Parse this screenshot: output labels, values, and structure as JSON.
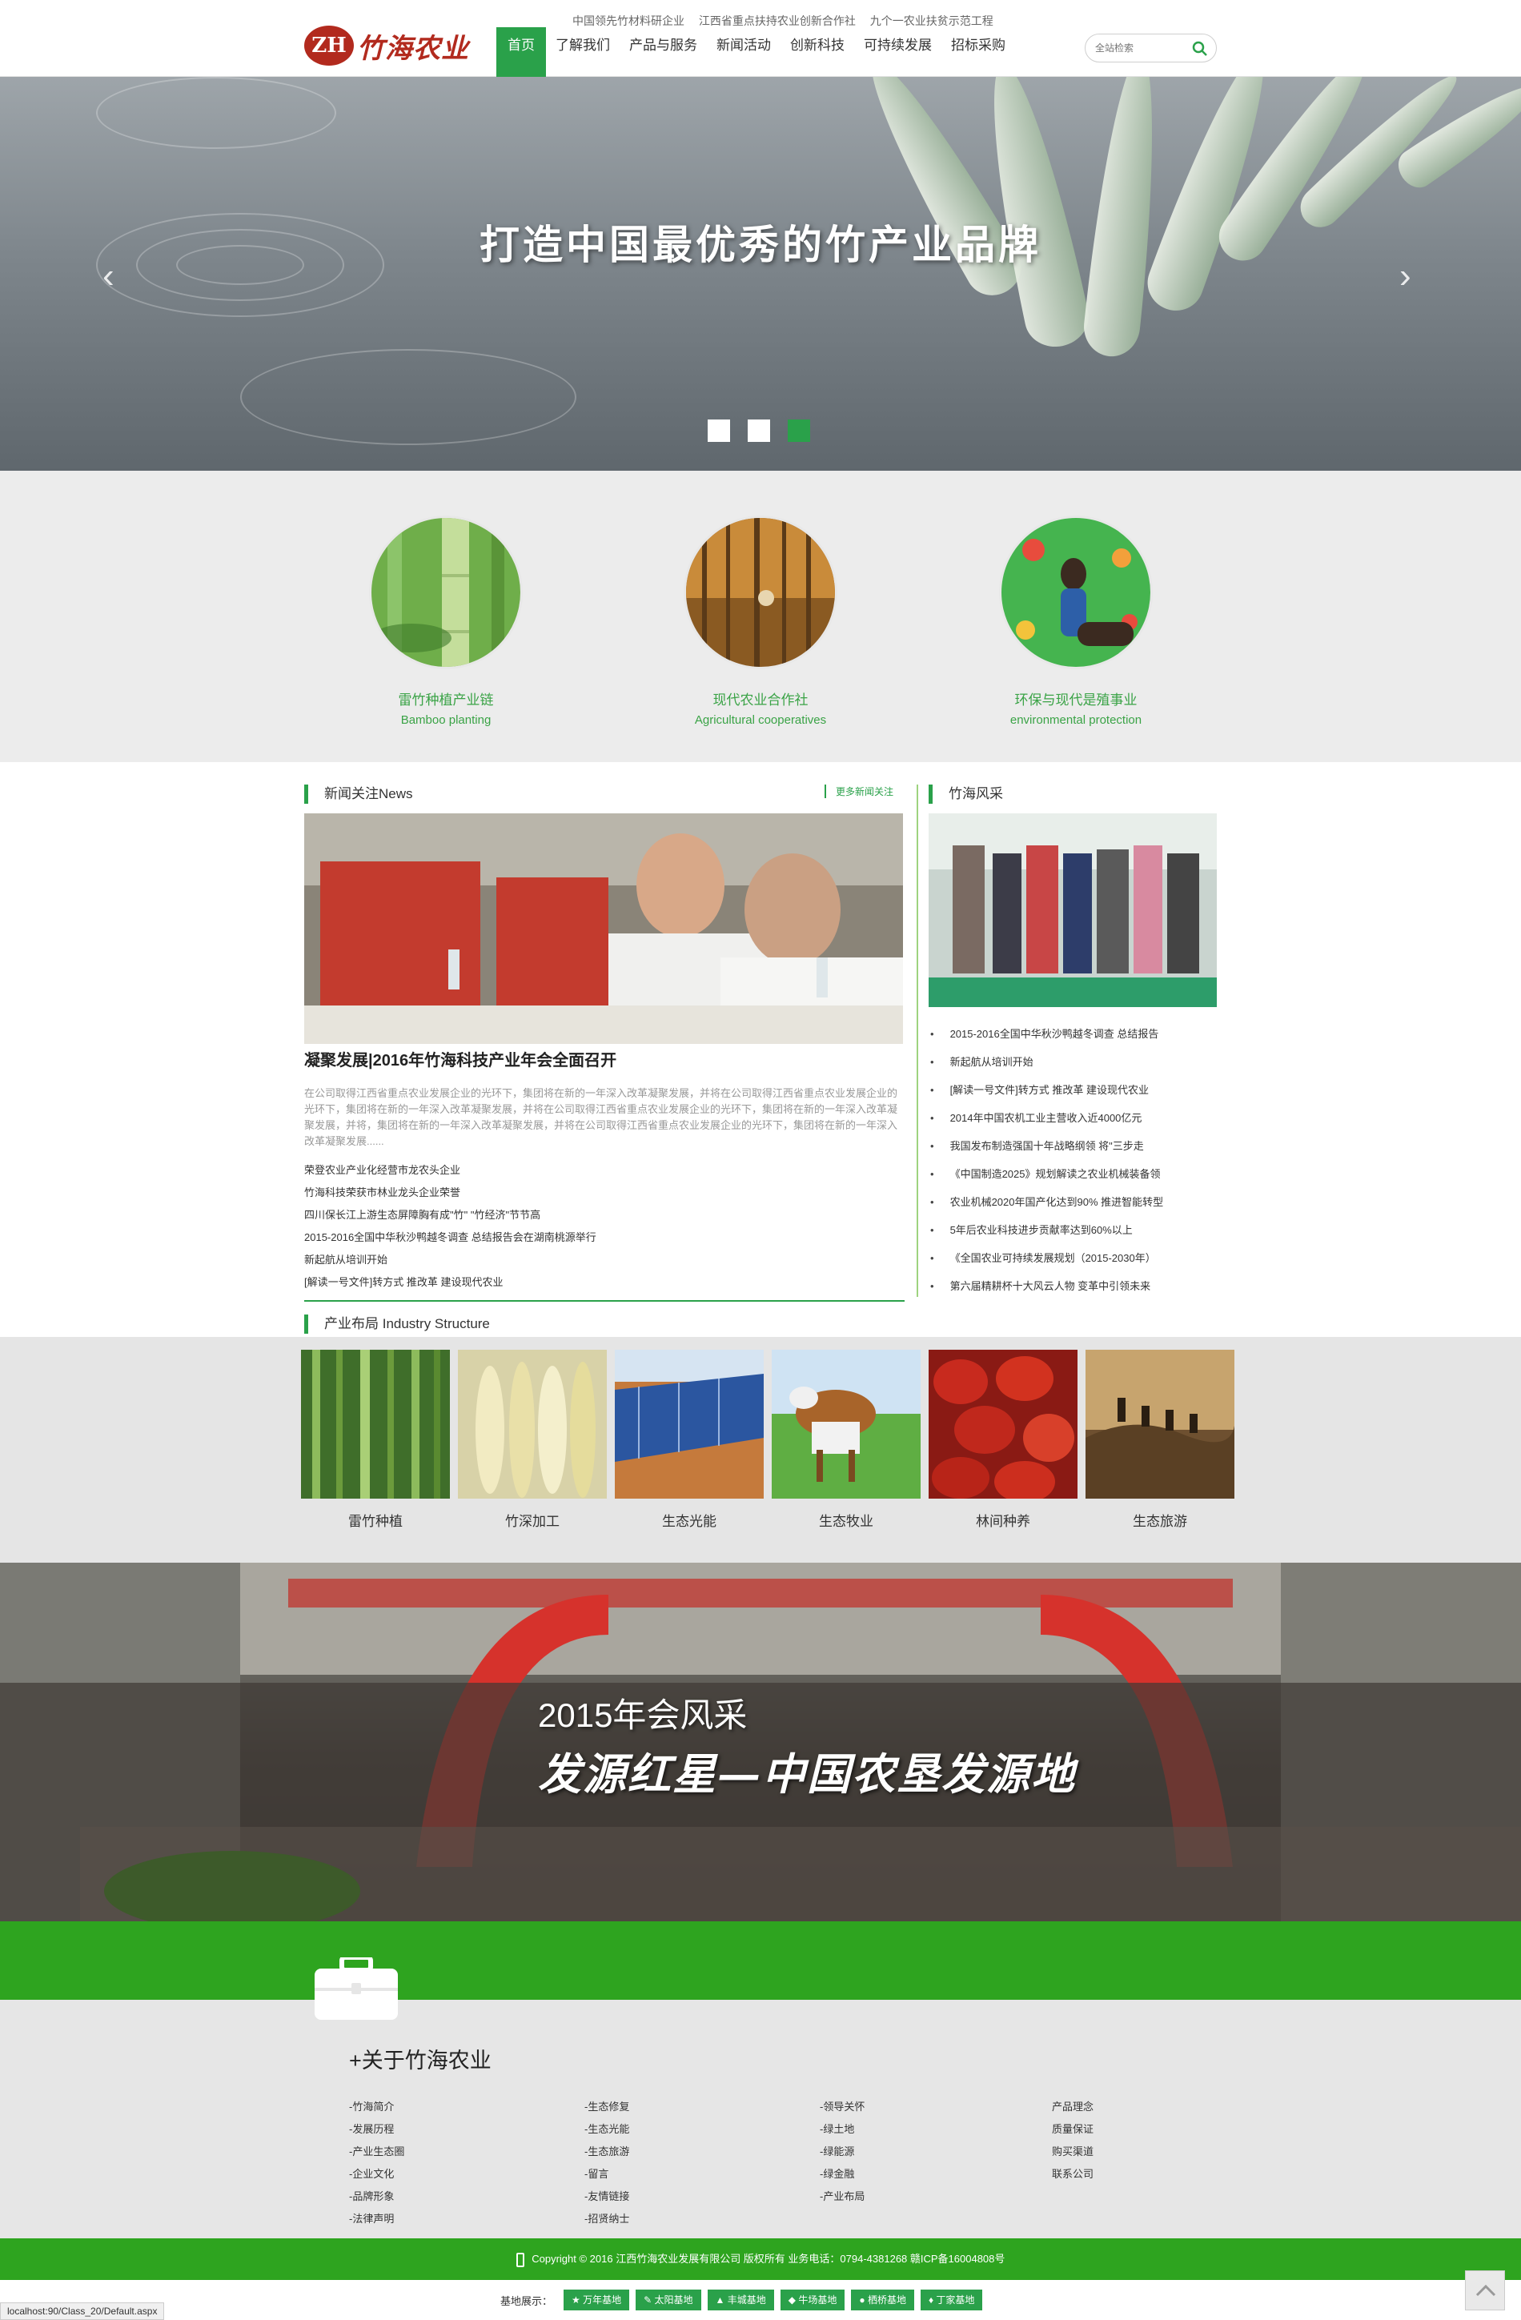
{
  "header": {
    "logo_badge": "ZH",
    "logo_text": "竹海农业",
    "taglines": [
      "中国领先竹材料研企业",
      "江西省重点扶持农业创新合作社",
      "九个一农业扶贫示范工程"
    ],
    "nav": [
      "首页",
      "了解我们",
      "产品与服务",
      "新闻活动",
      "创新科技",
      "可持续发展",
      "招标采购"
    ],
    "search_placeholder": "全站检索"
  },
  "banner": {
    "title": "打造中国最优秀的竹产业品牌",
    "prev": "‹",
    "next": "›",
    "slide_count": 3,
    "active_slide": 3
  },
  "features": [
    {
      "cn": "雷竹种植产业链",
      "en": "Bamboo planting"
    },
    {
      "cn": "现代农业合作社",
      "en": "Agricultural cooperatives"
    },
    {
      "cn": "环保与现代是殖事业",
      "en": "environmental protection"
    }
  ],
  "news": {
    "heading": "新闻关注News",
    "more": "更多新闻关注",
    "headline": "凝聚发展|2016年竹海科技产业年会全面召开",
    "summary": "在公司取得江西省重点农业发展企业的光环下，集团将在新的一年深入改革凝聚发展，并将在公司取得江西省重点农业发展企业的光环下，集团将在新的一年深入改革凝聚发展，并将在公司取得江西省重点农业发展企业的光环下，集团将在新的一年深入改革凝聚发展，并将，集团将在新的一年深入改革凝聚发展，并将在公司取得江西省重点农业发展企业的光环下，集团将在新的一年深入改革凝聚发展......",
    "items": [
      "荣登农业产业化经营市龙农头企业",
      "竹海科技荣获市林业龙头企业荣誉",
      "四川保长江上游生态屏障胸有成\"竹\" \"竹经济\"节节高",
      "2015-2016全国中华秋沙鸭越冬调查 总结报告会在湖南桃源举行",
      "新起航从培训开始",
      "[解读一号文件]转方式 推改革 建设现代农业"
    ]
  },
  "side": {
    "heading": "竹海风采",
    "items": [
      "2015-2016全国中华秋沙鸭越冬调查 总结报告",
      "新起航从培训开始",
      "[解读一号文件]转方式 推改革 建设现代农业",
      "2014年中国农机工业主营收入近4000亿元",
      "我国发布制造强国十年战略纲领 将\"三步走",
      "《中国制造2025》规划解读之农业机械装备领",
      "农业机械2020年国产化达到90% 推进智能转型",
      "5年后农业科技进步贡献率达到60%以上",
      "《全国农业可持续发展规划（2015-2030年）",
      "第六届精耕杯十大风云人物 变革中引领未来"
    ]
  },
  "industry": {
    "heading": "产业布局 Industry Structure",
    "items": [
      "雷竹种植",
      "竹深加工",
      "生态光能",
      "生态牧业",
      "林间种养",
      "生态旅游"
    ]
  },
  "group": {
    "line1": "2015年会风采",
    "line2": "发源红星—中国农垦发源地"
  },
  "footer": {
    "about_title": "+关于竹海农业",
    "columns": [
      [
        "-竹海简介",
        "-发展历程",
        "-产业生态圈",
        "-企业文化",
        "-品牌形象",
        "-法律声明"
      ],
      [
        "-生态修复",
        "-生态光能",
        "-生态旅游",
        "-留言",
        "-友情链接",
        "-招贤纳士"
      ],
      [
        "-领导关怀",
        "-绿土地",
        "-绿能源",
        "-绿金融",
        "-产业布局"
      ],
      [
        "产品理念",
        "质量保证",
        "购买渠道",
        "联系公司"
      ]
    ],
    "copyright": "Copyright © 2016 江西竹海农业发展有限公司 版权所有 业务电话：0794-4381268 赣ICP备16004808号",
    "base_label": "基地展示：",
    "bases": [
      "万年基地",
      "太阳基地",
      "丰城基地",
      "牛场基地",
      "栖桥基地",
      "丁家基地"
    ],
    "status_url": "localhost:90/Class_20/Default.aspx"
  }
}
